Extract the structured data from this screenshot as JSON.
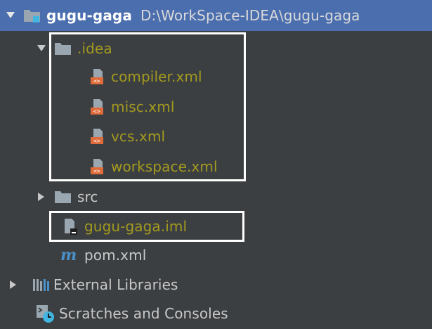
{
  "tree": {
    "root": {
      "name": "gugu-gaga",
      "path": "D:\\WorkSpace-IDEA\\gugu-gaga"
    },
    "idea_folder": {
      "label": ".idea"
    },
    "idea_files": [
      {
        "label": "compiler.xml"
      },
      {
        "label": "misc.xml"
      },
      {
        "label": "vcs.xml"
      },
      {
        "label": "workspace.xml"
      }
    ],
    "src_folder": {
      "label": "src"
    },
    "iml_file": {
      "label": "gugu-gaga.iml"
    },
    "pom_file": {
      "label": "pom.xml"
    },
    "external_libraries": {
      "label": "External Libraries"
    },
    "scratches": {
      "label": "Scratches and Consoles"
    }
  },
  "colors": {
    "panel_bg": "#3c3f41",
    "selection": "#4b6eaf",
    "ignored_text": "#a39a1f",
    "highlight_box": "#ffffff"
  },
  "icons": {
    "expand_arrow": "triangle-down-icon",
    "collapse_arrow": "triangle-right-icon",
    "module": "module-folder-icon",
    "folder": "folder-icon",
    "xml": "xml-file-icon",
    "iml": "iml-file-icon",
    "maven": "maven-icon",
    "libraries": "libraries-icon",
    "scratches": "scratches-icon"
  }
}
